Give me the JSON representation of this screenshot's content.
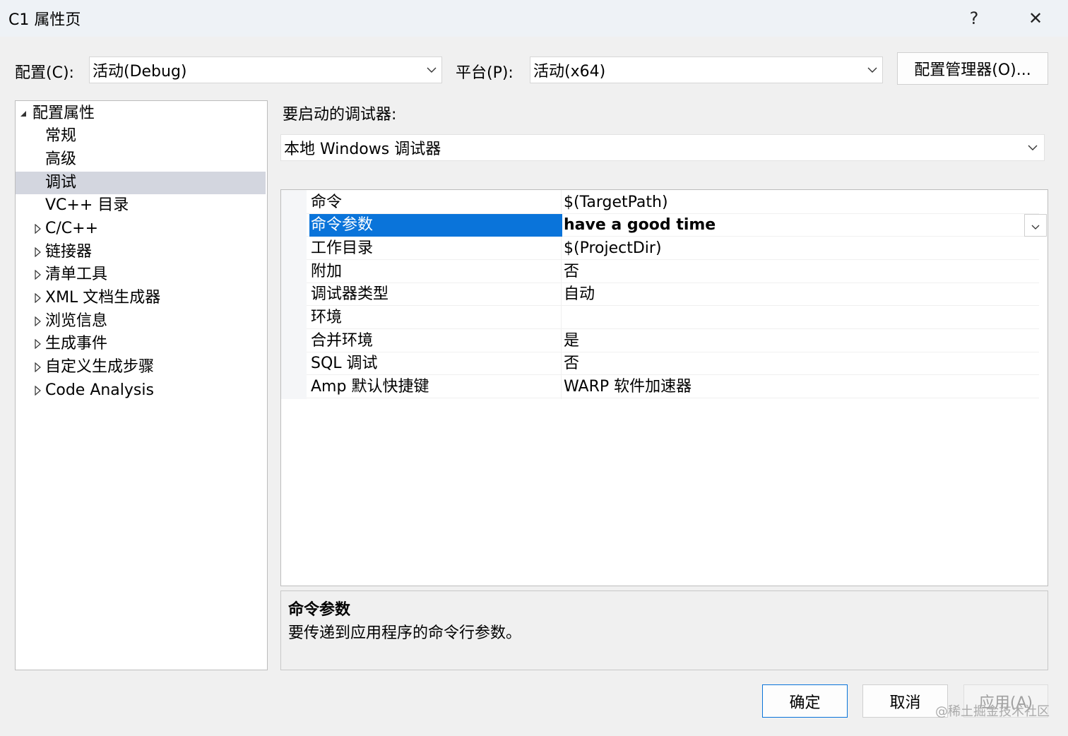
{
  "window": {
    "title": "C1 属性页",
    "help_glyph": "?",
    "close_glyph": "✕"
  },
  "toolbar": {
    "config_label": "配置(C):",
    "config_value": "活动(Debug)",
    "platform_label": "平台(P):",
    "platform_value": "活动(x64)",
    "config_manager_button": "配置管理器(O)..."
  },
  "tree": {
    "items": [
      {
        "label": "配置属性",
        "expander": "expanded",
        "level": 0
      },
      {
        "label": "常规",
        "expander": "none",
        "level": 1
      },
      {
        "label": "高级",
        "expander": "none",
        "level": 1
      },
      {
        "label": "调试",
        "expander": "none",
        "level": 1,
        "selected": true
      },
      {
        "label": "VC++ 目录",
        "expander": "none",
        "level": 1
      },
      {
        "label": "C/C++",
        "expander": "collapsed",
        "level": 1
      },
      {
        "label": "链接器",
        "expander": "collapsed",
        "level": 1
      },
      {
        "label": "清单工具",
        "expander": "collapsed",
        "level": 1
      },
      {
        "label": "XML 文档生成器",
        "expander": "collapsed",
        "level": 1
      },
      {
        "label": "浏览信息",
        "expander": "collapsed",
        "level": 1
      },
      {
        "label": "生成事件",
        "expander": "collapsed",
        "level": 1
      },
      {
        "label": "自定义生成步骤",
        "expander": "collapsed",
        "level": 1
      },
      {
        "label": "Code Analysis",
        "expander": "collapsed",
        "level": 1
      }
    ]
  },
  "debugger": {
    "label": "要启动的调试器:",
    "value": "本地 Windows 调试器"
  },
  "properties": [
    {
      "name": "命令",
      "value": "$(TargetPath)"
    },
    {
      "name": "命令参数",
      "value": "have a good time",
      "selected": true
    },
    {
      "name": "工作目录",
      "value": "$(ProjectDir)"
    },
    {
      "name": "附加",
      "value": "否"
    },
    {
      "name": "调试器类型",
      "value": "自动"
    },
    {
      "name": "环境",
      "value": ""
    },
    {
      "name": "合并环境",
      "value": "是"
    },
    {
      "name": "SQL 调试",
      "value": "否"
    },
    {
      "name": "Amp 默认快捷键",
      "value": "WARP 软件加速器"
    }
  ],
  "description": {
    "title": "命令参数",
    "text": "要传递到应用程序的命令行参数。"
  },
  "buttons": {
    "ok": "确定",
    "cancel": "取消",
    "apply": "应用(A)"
  },
  "watermark": "@稀土掘金技术社区",
  "colors": {
    "selection": "#0a74da",
    "tree_selection": "#d3d6df",
    "ok_border": "#0a74da"
  }
}
